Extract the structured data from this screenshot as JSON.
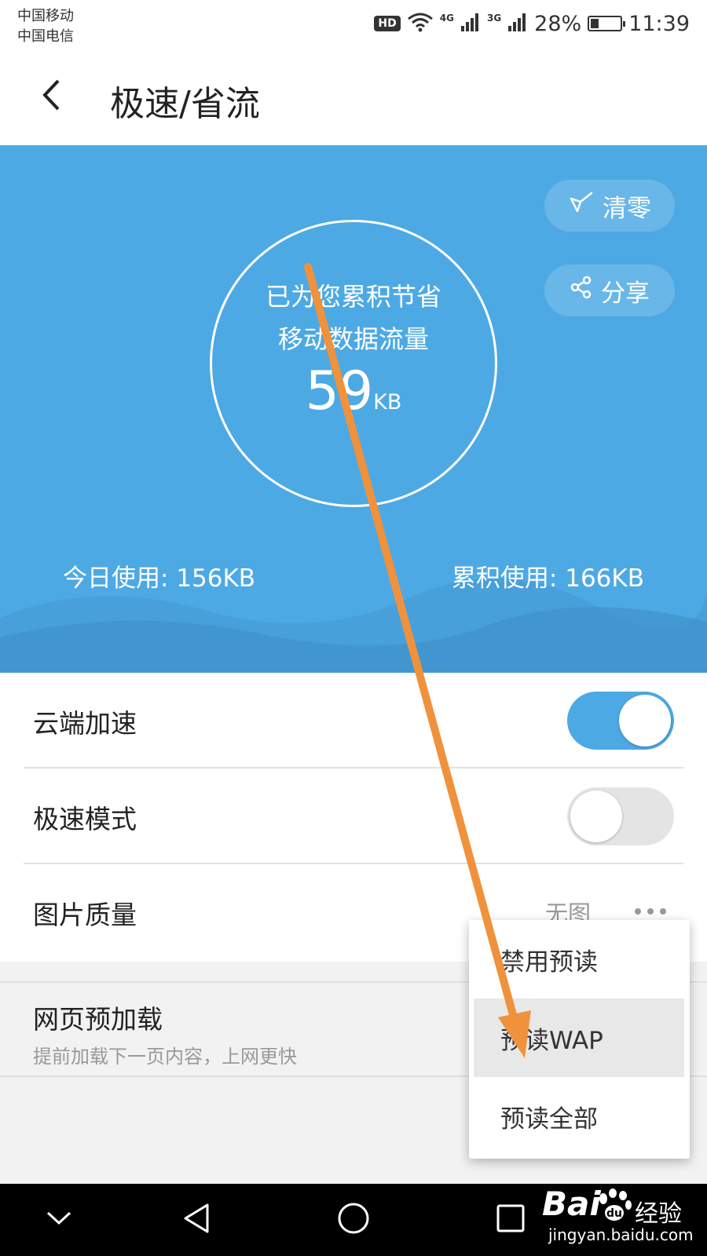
{
  "status_bar": {
    "carrier_1": "中国移动",
    "carrier_2": "中国电信",
    "hd_badge": "HD",
    "network_1": "4G",
    "network_2": "3G",
    "battery_percent": "28%",
    "battery_level": 0.28,
    "time": "11:39"
  },
  "header": {
    "title": "极速/省流",
    "back_icon": "chevron-left-icon"
  },
  "hero": {
    "clear_label": "清零",
    "share_label": "分享",
    "saved_line_1": "已为您累积节省",
    "saved_line_2": "移动数据流量",
    "saved_value": "59",
    "saved_unit": "KB",
    "today_usage": "今日使用: 156KB",
    "total_usage": "累积使用: 166KB",
    "background_color": "#4da9e4"
  },
  "settings": [
    {
      "label": "云端加速",
      "type": "toggle",
      "on": true
    },
    {
      "label": "极速模式",
      "type": "toggle",
      "on": false
    },
    {
      "label": "图片质量",
      "type": "select",
      "value": "无图"
    }
  ],
  "preload": {
    "title": "网页预加载",
    "description": "提前加载下一页内容，上网更快"
  },
  "dropdown": {
    "options": [
      "禁用预读",
      "预读WAP",
      "预读全部"
    ],
    "highlighted": "预读WAP"
  },
  "nav_bar": {
    "icons": [
      "chevron-down-icon",
      "back-triangle-icon",
      "home-circle-icon",
      "recents-square-icon"
    ]
  },
  "watermark": {
    "brand": "Bai",
    "brand_cn": "经验",
    "url": "jingyan.baidu.com"
  },
  "colors": {
    "accent": "#4da9e4",
    "annotation_arrow": "#f0923c"
  }
}
